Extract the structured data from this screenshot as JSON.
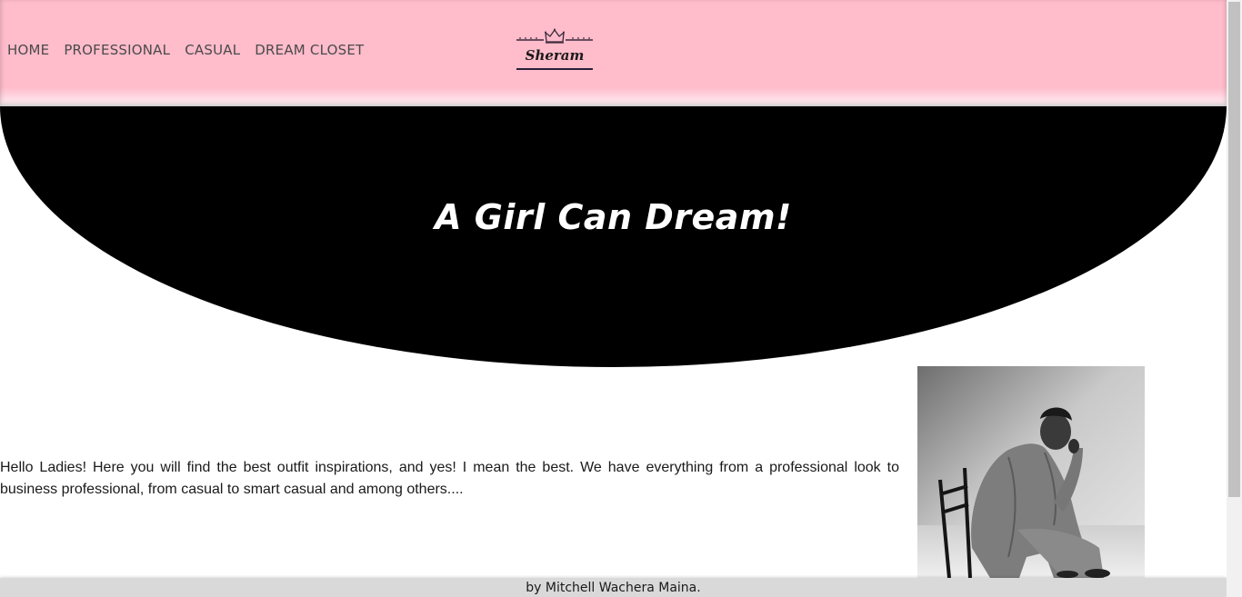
{
  "nav": {
    "items": [
      {
        "label": "HOME"
      },
      {
        "label": "PROFESSIONAL"
      },
      {
        "label": "CASUAL"
      },
      {
        "label": "DREAM CLOSET"
      }
    ]
  },
  "logo": {
    "text": "Sheram",
    "icon": "crown-icon"
  },
  "hero": {
    "title": "A Girl Can Dream!"
  },
  "intro": {
    "text": "Hello Ladies! Here you will find the best outfit inspirations, and yes! I mean the best. We have everything from a professional look to business professional, from casual to smart casual and among others...."
  },
  "photo": {
    "icon": "woman-seated-photo"
  },
  "footer": {
    "text": "by Mitchell Wachera Maina."
  },
  "colors": {
    "header_pink": "#ffbccb",
    "hero_black": "#000000",
    "footer_gray": "#d9d9d9"
  }
}
